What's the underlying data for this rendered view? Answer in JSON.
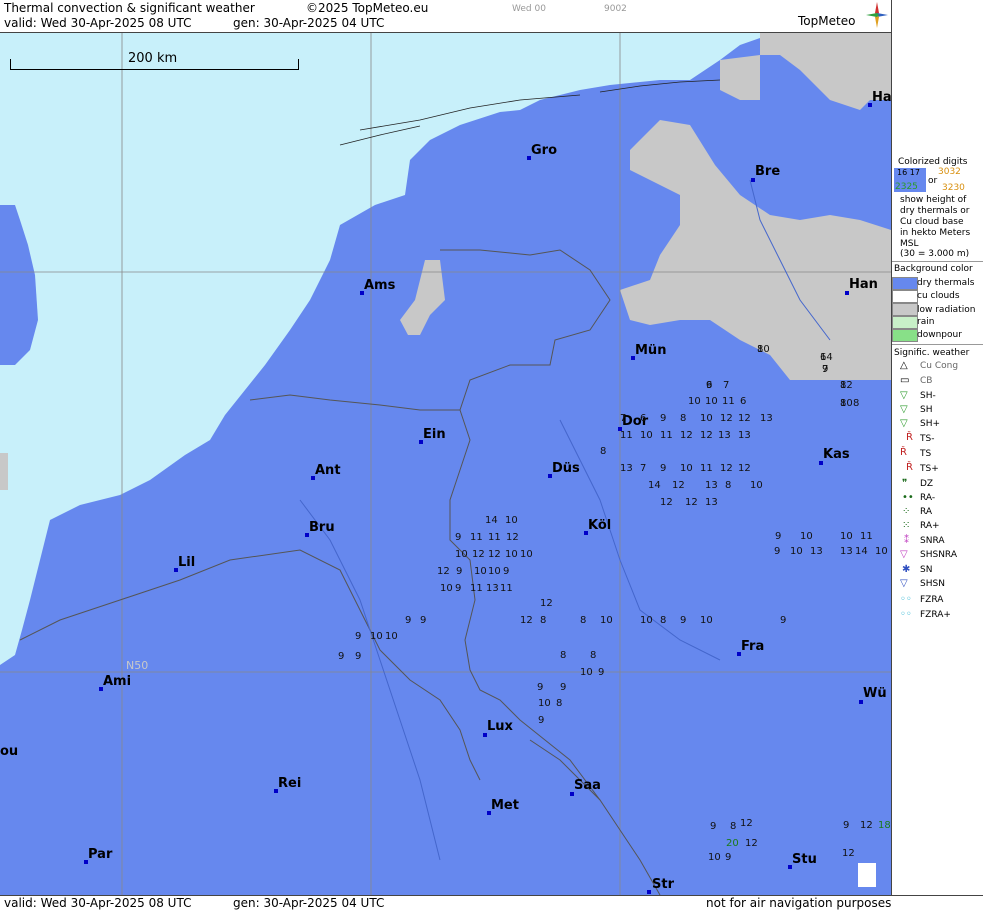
{
  "header": {
    "title": "Thermal convection & significant weather",
    "copyright": "©2025 TopMeteo.eu",
    "valid": "valid:  Wed  30-Apr-2025  08 UTC",
    "generated": "gen:  30-Apr-2025 04 UTC",
    "small1": "Wed 00",
    "small2": "9002",
    "logo": "TopMeteo"
  },
  "map": {
    "scale_label": "200 km",
    "lat_label": "N50",
    "cities": [
      {
        "name": "Gro"
      },
      {
        "name": "Bre"
      },
      {
        "name": "Ha"
      },
      {
        "name": "Ams"
      },
      {
        "name": "Han"
      },
      {
        "name": "Mün"
      },
      {
        "name": "Dor"
      },
      {
        "name": "Ein"
      },
      {
        "name": "Kas"
      },
      {
        "name": "Düs"
      },
      {
        "name": "Ant"
      },
      {
        "name": "Köl"
      },
      {
        "name": "Bru"
      },
      {
        "name": "Lil"
      },
      {
        "name": "Fra"
      },
      {
        "name": "Ami"
      },
      {
        "name": "Wü"
      },
      {
        "name": "Lux"
      },
      {
        "name": "Rei"
      },
      {
        "name": "Saa"
      },
      {
        "name": "Met"
      },
      {
        "name": "Par"
      },
      {
        "name": "Stu"
      },
      {
        "name": "Str"
      },
      {
        "name": "ou"
      }
    ]
  },
  "legend": {
    "colorized_title": "Colorized digits",
    "sample1": "16  17",
    "sample2": "3032",
    "or": "or",
    "sample3": "2325",
    "sample4": "3230",
    "desc": [
      "show height of",
      "dry thermals or",
      "Cu cloud base",
      "in hekto Meters",
      "MSL",
      "(30 = 3.000 m)"
    ],
    "bg_title": "Background color",
    "bg_items": [
      "dry thermals",
      "cu clouds",
      "low radiation",
      "rain",
      "downpour"
    ],
    "bg_colors": [
      "#6688ee",
      "#ffffff",
      "#c8c8c8",
      "#c8f0c8",
      "#88e088"
    ],
    "sig_title": "Signific. weather",
    "sig_items": [
      "Cu Cong",
      "CB",
      "SH-",
      "SH",
      "SH+",
      "TS-",
      "TS",
      "TS+",
      "DZ",
      "RA-",
      "RA",
      "RA+",
      "SNRA",
      "SHSNRA",
      "SN",
      "SHSN",
      "FZRA",
      "FZRA+"
    ]
  },
  "footer": {
    "valid": "valid:  Wed  30-Apr-2025  08 UTC",
    "generated": "gen:  30-Apr-2025 04 UTC",
    "disclaimer": "not for air navigation purposes"
  },
  "digits": [
    "8",
    "6",
    "8",
    "7",
    "8",
    "6",
    "7",
    "8",
    "10",
    "10",
    "11",
    "6",
    "7",
    "6",
    "9",
    "8",
    "10",
    "12",
    "12",
    "13",
    "8",
    "11",
    "10",
    "11",
    "12",
    "12",
    "13",
    "13",
    "13",
    "7",
    "9",
    "10",
    "11",
    "12",
    "12",
    "14",
    "12",
    "13",
    "8",
    "10",
    "12",
    "12",
    "13",
    "14",
    "10",
    "9",
    "11",
    "11",
    "12",
    "10",
    "12",
    "12",
    "10",
    "10",
    "9",
    "10",
    "10",
    "9",
    "12",
    "10",
    "9",
    "11",
    "13",
    "11",
    "9",
    "10",
    "13",
    "13",
    "14",
    "10",
    "9",
    "10",
    "10",
    "11",
    "12",
    "12",
    "8",
    "8",
    "10",
    "10",
    "8",
    "9",
    "10",
    "9",
    "8",
    "8",
    "10",
    "9",
    "9",
    "9",
    "10",
    "8",
    "9",
    "9",
    "9",
    "9",
    "10",
    "10",
    "9",
    "9",
    "10",
    "9",
    "9",
    "8",
    "9",
    "12",
    "18",
    "20",
    "12",
    "12",
    "12",
    "10",
    "14",
    "12",
    "9",
    "10",
    "9"
  ]
}
